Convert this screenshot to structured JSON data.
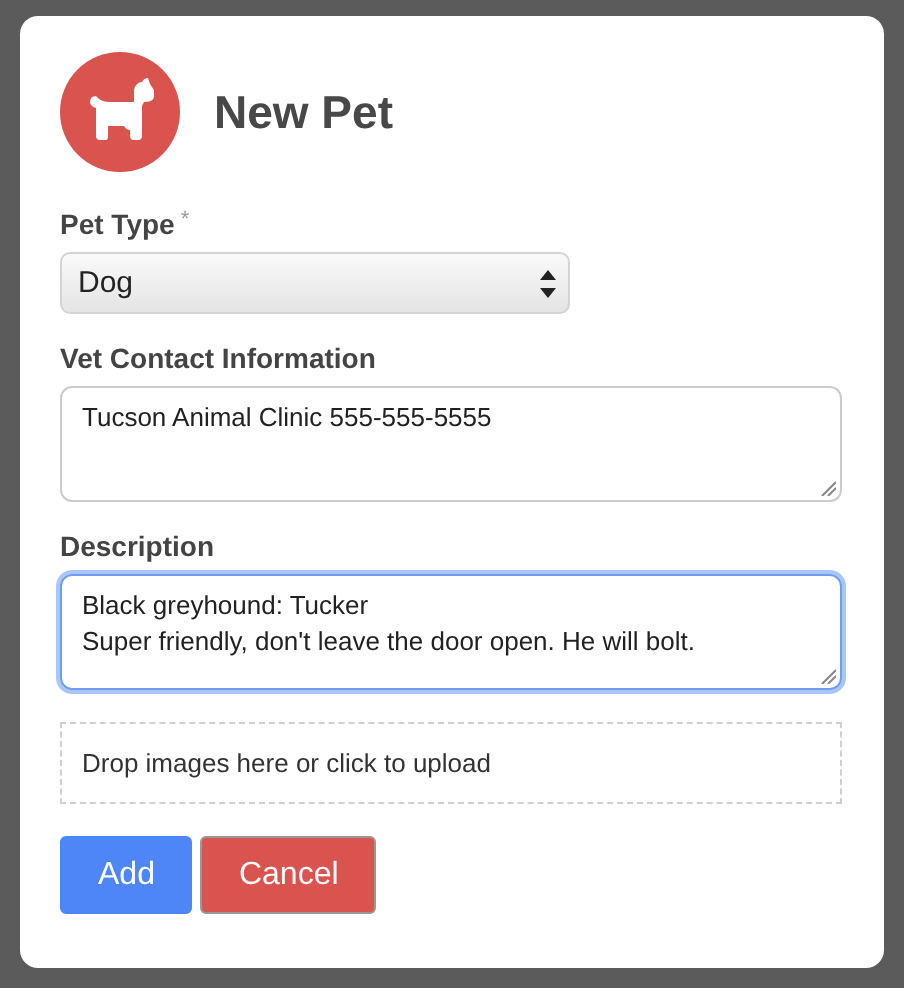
{
  "modal": {
    "title": "New Pet"
  },
  "fields": [
    {
      "kind": "select",
      "label": "Pet Type",
      "required_mark": "*",
      "value": "Dog"
    },
    {
      "kind": "textarea",
      "label": "Vet Contact Information",
      "value": "Tucson Animal Clinic 555-555-5555",
      "focused": false
    },
    {
      "kind": "textarea",
      "label": "Description",
      "value": "Black greyhound: Tucker\nSuper friendly, don't leave the door open. He will bolt.",
      "focused": true
    }
  ],
  "dropzone": {
    "text": "Drop images here or click to upload"
  },
  "buttons": [
    {
      "label": "Add",
      "kind": "primary"
    },
    {
      "label": "Cancel",
      "kind": "danger"
    }
  ]
}
